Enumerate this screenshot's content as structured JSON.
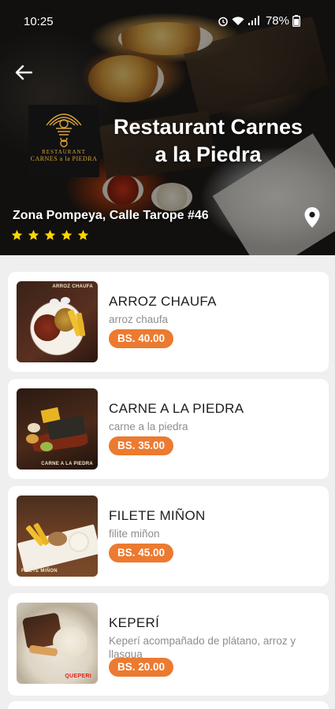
{
  "status_bar": {
    "time": "10:25",
    "battery": "78%"
  },
  "restaurant": {
    "name": "Restaurant Carnes a la Piedra",
    "address": "Zona Pompeya, Calle Tarope #46",
    "rating": 5,
    "logo": {
      "line1": "RESTAURANT",
      "line2": "CARNES a la PIEDRA"
    }
  },
  "menu": [
    {
      "name": "ARROZ CHAUFA",
      "description": "arroz chaufa",
      "price": "BS. 40.00",
      "thumb_label": "ARROZ CHAUFA"
    },
    {
      "name": "CARNE A LA PIEDRA",
      "description": "carne a la piedra",
      "price": "BS. 35.00",
      "thumb_label": "CARNE A LA PIEDRA"
    },
    {
      "name": "FILETE MIÑON",
      "description": "filite miñon",
      "price": "BS. 45.00",
      "thumb_label": "FILETE MIÑON"
    },
    {
      "name": "KEPERÍ",
      "description": "Keperí acompañado de plátano, arroz y llasgua",
      "price": "BS. 20.00",
      "thumb_label": "QUEPERI"
    }
  ],
  "colors": {
    "accent": "#ec7a30",
    "star": "#ffd600",
    "background": "#efefef"
  },
  "icons": {
    "back": "arrow-left-icon",
    "location": "map-pin-icon",
    "star": "star-icon"
  }
}
